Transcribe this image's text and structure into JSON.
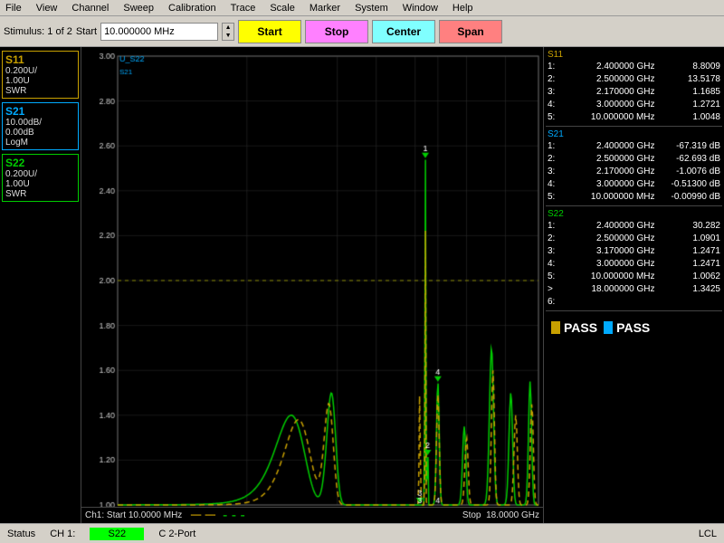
{
  "menubar": {
    "items": [
      "File",
      "View",
      "Channel",
      "Sweep",
      "Calibration",
      "Trace",
      "Scale",
      "Marker",
      "System",
      "Window",
      "Help"
    ]
  },
  "toolbar": {
    "stimulus_label": "Stimulus: 1 of 2",
    "start_label": "Start",
    "start_value": "10.000000 MHz",
    "btn_start": "Start",
    "btn_stop": "Stop",
    "btn_center": "Center",
    "btn_span": "Span"
  },
  "traces": [
    {
      "name": "S11",
      "line1": "0.200U/",
      "line2": "1.00U",
      "line3": "SWR",
      "color": "#c8a000"
    },
    {
      "name": "S21",
      "line1": "10.00dB/",
      "line2": "0.00dB",
      "line3": "LogM",
      "color": "#00aaff"
    },
    {
      "name": "S22",
      "line1": "0.200U/",
      "line2": "1.00U",
      "line3": "SWR",
      "color": "#00cc00"
    }
  ],
  "markers_s11": [
    {
      "num": "1:",
      "freq": "2.400000 GHz",
      "val": "8.8009"
    },
    {
      "num": "2:",
      "freq": "2.500000 GHz",
      "val": "13.5178"
    },
    {
      "num": "3:",
      "freq": "2.170000 GHz",
      "val": "1.1685"
    },
    {
      "num": "4:",
      "freq": "3.000000 GHz",
      "val": "1.2721"
    },
    {
      "num": "5:",
      "freq": "10.000000 MHz",
      "val": "1.0048"
    }
  ],
  "markers_s21": [
    {
      "num": "1:",
      "freq": "2.400000 GHz",
      "val": "-67.319 dB"
    },
    {
      "num": "2:",
      "freq": "2.500000 GHz",
      "val": "-62.693 dB"
    },
    {
      "num": "3:",
      "freq": "2.170000 GHz",
      "val": "-1.0076 dB"
    },
    {
      "num": "4:",
      "freq": "3.000000 GHz",
      "val": "-0.51300 dB"
    },
    {
      "num": "5:",
      "freq": "10.000000 MHz",
      "val": "-0.00990 dB"
    }
  ],
  "markers_s22": [
    {
      "num": "1:",
      "freq": "2.400000 GHz",
      "val": "30.282"
    },
    {
      "num": "2:",
      "freq": "2.500000 GHz",
      "val": "1.0901"
    },
    {
      "num": "3:",
      "freq": "3.170000 GHz",
      "val": "1.2471"
    },
    {
      "num": "4:",
      "freq": "3.000000 GHz",
      "val": "1.2471"
    },
    {
      "num": "5:",
      "freq": "10.000000 MHz",
      "val": "1.0062"
    },
    {
      "num": "> 6:",
      "freq": "18.000000 GHz",
      "val": "1.3425"
    }
  ],
  "pass_indicators": [
    {
      "color": "#c8a000",
      "label": "PASS"
    },
    {
      "color": "#00aaff",
      "label": "PASS"
    }
  ],
  "chart": {
    "start_freq": "10.0000 MHz",
    "stop_freq": "18.0000 GHz",
    "y_labels": [
      "3.00",
      "2.80",
      "2.60",
      "2.40",
      "2.20",
      "2.00",
      "1.80",
      "1.60",
      "1.40",
      "1.20",
      "1.00"
    ],
    "ref_line_label": "U_S22",
    "ch1_label": "Ch1: Start",
    "stop_label": "Stop"
  },
  "statusbar": {
    "status_label": "Status",
    "ch_label": "CH 1:",
    "ch_value": "S22",
    "port_label": "C 2-Port",
    "right_label": "LCL"
  }
}
